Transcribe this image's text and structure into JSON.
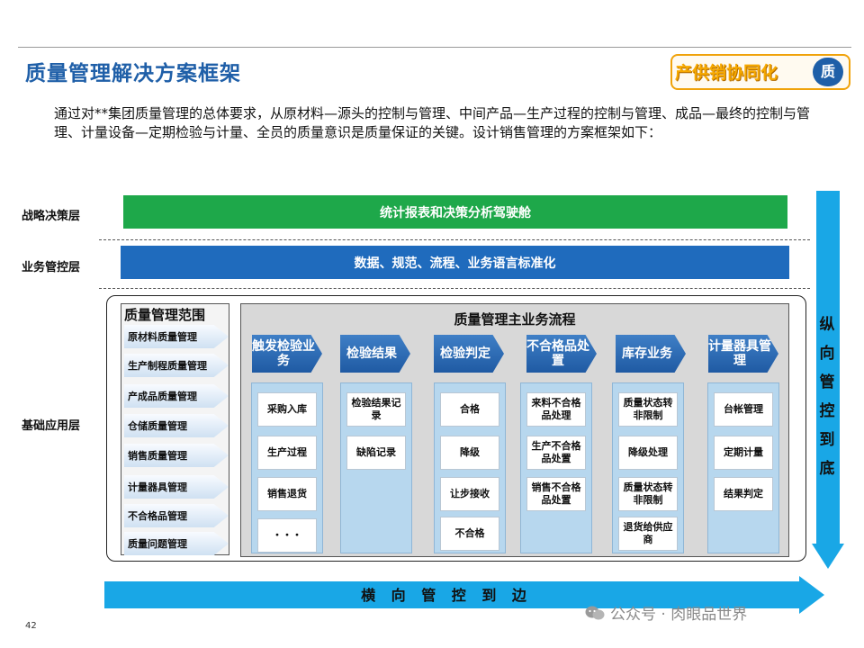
{
  "header": {
    "title": "质量管理解决方案框架",
    "badge_text": "产供销协同化",
    "badge_icon_text": "质"
  },
  "intro": {
    "text": "通过对**集团质量管理的总体要求，从原材料—源头的控制与管理、中间产品—生产过程的控制与管理、成品—最终的控制与管理、计量设备—定期检验与计量、全员的质量意识是质量保证的关键。设计销售管理的方案框架如下："
  },
  "layers": {
    "strategy": {
      "label": "战略决策层",
      "band": "统计报表和决策分析驾驶舱",
      "color": "#1ea84a"
    },
    "business": {
      "label": "业务管控层",
      "band": "数据、规范、流程、业务语言标准化",
      "color": "#1f6bbd"
    },
    "foundation": {
      "label": "基础应用层"
    }
  },
  "scope": {
    "title": "质量管理范围",
    "items": [
      "原材料质量管理",
      "生产制程质量管理",
      "产成品质量管理",
      "仓储质量管理",
      "销售质量管理",
      "计量器具管理",
      "不合格品管理",
      "质量问题管理"
    ]
  },
  "flow": {
    "title": "质量管理主业务流程",
    "stages": [
      {
        "label": "触发检验业务",
        "cells": [
          "采购入库",
          "生产过程",
          "销售退货",
          "・・・"
        ]
      },
      {
        "label": "检验结果",
        "cells": [
          "检验结果记录",
          "缺陷记录"
        ]
      },
      {
        "label": "检验判定",
        "cells": [
          "合格",
          "降级",
          "让步接收",
          "不合格"
        ]
      },
      {
        "label": "不合格品处置",
        "cells": [
          "来料不合格品处理",
          "生产不合格品处置",
          "销售不合格品处置"
        ]
      },
      {
        "label": "库存业务",
        "cells": [
          "质量状态转非限制",
          "降级处理",
          "质量状态转非限制",
          "退货给供应商"
        ]
      },
      {
        "label": "计量器具管理",
        "cells": [
          "台帐管理",
          "定期计量",
          "结果判定"
        ]
      }
    ]
  },
  "arrows": {
    "vertical": "纵向管控到底",
    "horizontal": "横 向 管 控 到 边",
    "color": "#19a7e6"
  },
  "footer": {
    "page_number": "42",
    "watermark": "公众号 · 肉眼品世界"
  }
}
